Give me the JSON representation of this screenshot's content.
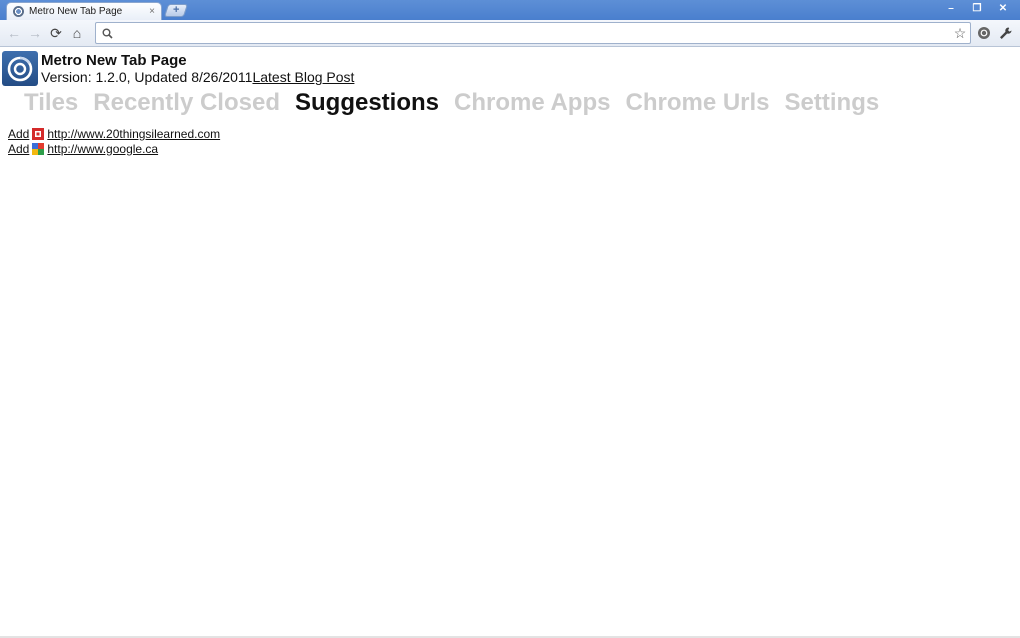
{
  "browser": {
    "tab_title": "Metro New Tab Page",
    "tab_close": "×",
    "newtab_label": "+",
    "window_controls": [
      "–",
      "❐",
      "✕"
    ]
  },
  "toolbar": {
    "back": "←",
    "forward": "→",
    "reload": "⟳",
    "home": "⌂",
    "omnibox_value": "",
    "star": "☆"
  },
  "app": {
    "title": "Metro New Tab Page",
    "version_text": "Version: 1.2.0, Updated 8/26/2011",
    "blog_link": "Latest Blog Post"
  },
  "nav": {
    "items": [
      "Tiles",
      "Recently Closed",
      "Suggestions",
      "Chrome Apps",
      "Chrome Urls",
      "Settings"
    ],
    "active": "Suggestions"
  },
  "suggestions": [
    {
      "add_label": "Add",
      "url": "http://www.20thingsilearned.com",
      "icon": "20things-favicon"
    },
    {
      "add_label": "Add",
      "url": "http://www.google.ca",
      "icon": "google-favicon"
    }
  ],
  "colors": {
    "titlebar": "#4a7fce",
    "nav_inactive": "#cccccc",
    "nav_active": "#111111",
    "logo_tile": "#2f5c99"
  }
}
